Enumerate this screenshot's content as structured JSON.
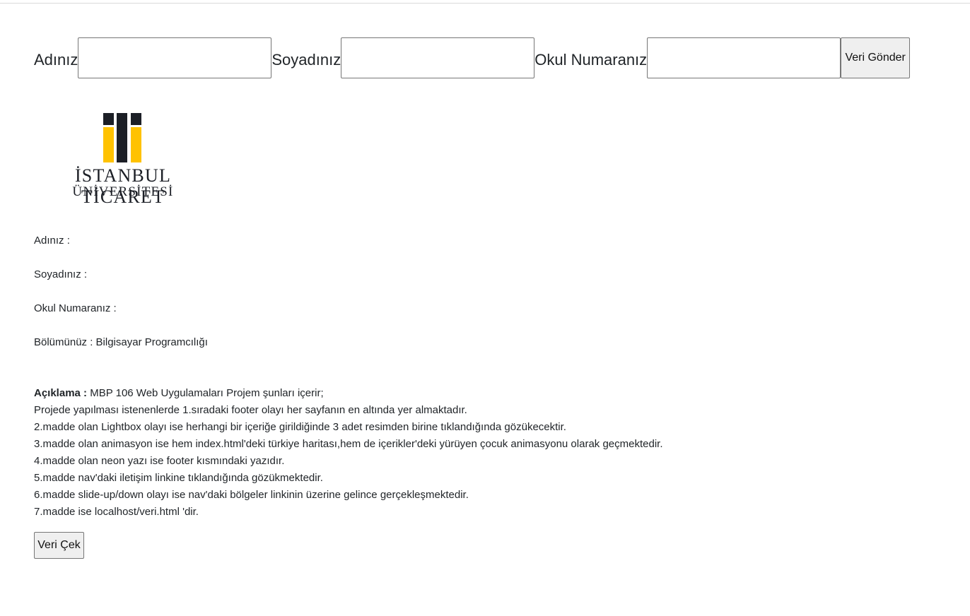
{
  "form": {
    "first_name_label": "Adınız",
    "first_name_value": "",
    "last_name_label": "Soyadınız",
    "last_name_value": "",
    "student_number_label": "Okul Numaranız",
    "student_number_value": "",
    "submit_label": "Veri Gönder"
  },
  "logo": {
    "name": "İSTANBUL TİCARET",
    "sub": "ÜNİVERSİTESİ"
  },
  "info": {
    "first_name": "Adınız :",
    "last_name": "Soyadınız :",
    "student_number": "Okul Numaranız :",
    "department": "Bölümünüz : Bilgisayar Programcılığı"
  },
  "description": {
    "heading": "Açıklama :",
    "intro": " MBP 106 Web Uygulamaları Projem şunları içerir;",
    "lines": [
      "Projede yapılması istenenlerde 1.sıradaki footer olayı her sayfanın en altında yer almaktadır.",
      "2.madde olan Lightbox olayı ise herhangi bir içeriğe girildiğinde 3 adet resimden birine tıklandığında gözükecektir.",
      "3.madde olan animasyon ise hem index.html'deki türkiye haritası,hem de içerikler'deki yürüyen çocuk animasyonu olarak geçmektedir.",
      "4.madde olan neon yazı ise footer kısmındaki yazıdır.",
      "5.madde nav'daki iletişim linkine tıklandığında gözükmektedir.",
      "6.madde slide-up/down olayı ise nav'daki bölgeler linkinin üzerine gelince gerçekleşmektedir.",
      "7.madde ise localhost/veri.html 'dir."
    ]
  },
  "fetch_button_label": "Veri Çek",
  "colors": {
    "logo_yellow": "#FFC200",
    "logo_dark": "#1C1F26"
  }
}
